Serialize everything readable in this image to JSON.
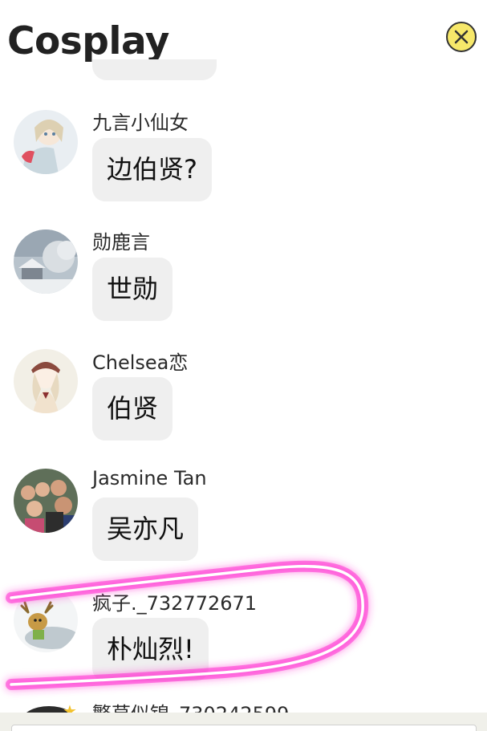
{
  "header": {
    "title": "Cosplay",
    "close_icon": "close-icon"
  },
  "colors": {
    "bubble_bg": "#efefef",
    "close_bg": "#f7e86a",
    "highlight_stroke": "#ff2ed0"
  },
  "messages": [
    {
      "user": "九言小仙女",
      "text": "边伯贤?",
      "avatar": "anime-girl-avatar"
    },
    {
      "user": "勋鹿言",
      "text": "世勋",
      "avatar": "snowy-house-avatar"
    },
    {
      "user": "Chelsea恋",
      "text": "伯贤",
      "avatar": "anime-hat-girl-avatar"
    },
    {
      "user": "Jasmine Tan",
      "text": "吴亦凡",
      "avatar": "group-photo-avatar"
    },
    {
      "user": "疯子._732772671",
      "text": "朴灿烈!",
      "avatar": "moose-cartoon-avatar"
    }
  ],
  "partial_next": {
    "user": "繁草似锦_730242599"
  }
}
